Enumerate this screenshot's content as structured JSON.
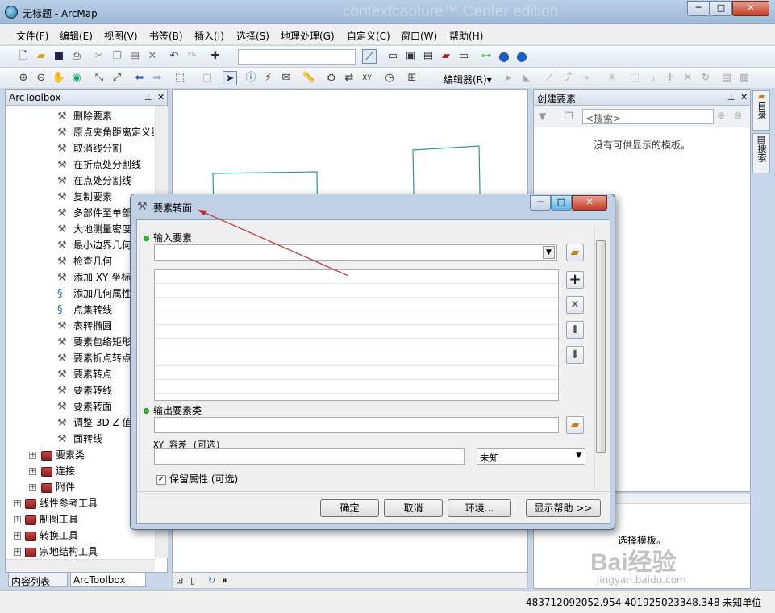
{
  "window": {
    "title": "无标题 - ArcMap",
    "watermark": "contextcapture™ Center edition",
    "min": "─",
    "max": "□",
    "close": "✕"
  },
  "menu": [
    "文件(F)",
    "编辑(E)",
    "视图(V)",
    "书签(B)",
    "插入(I)",
    "选择(S)",
    "地理处理(G)",
    "自定义(C)",
    "窗口(W)",
    "帮助(H)"
  ],
  "toolbar2": {
    "editor_label": "编辑器(R)▾"
  },
  "toolbox": {
    "title": "ArcToolbox",
    "items": [
      "删除要素",
      "原点夹角距离定义线",
      "取消线分割",
      "在折点处分割线",
      "在点处分割线",
      "复制要素",
      "多部件至单部件",
      "大地测量密度",
      "最小边界几何",
      "检查几何",
      "添加 XY 坐标",
      "添加几何属性",
      "点集转线",
      "表转椭圆",
      "要素包络矩形",
      "要素折点转点",
      "要素转点",
      "要素转线",
      "要素转面",
      "调整 3D Z 值",
      "面转线"
    ],
    "sets": [
      "要素类",
      "连接",
      "附件"
    ],
    "toolboxes": [
      "线性参考工具",
      "制图工具",
      "转换工具",
      "宗地结构工具"
    ],
    "tabs": [
      "内容列表",
      "ArcToolbox"
    ]
  },
  "create_features": {
    "title": "创建要素",
    "search_placeholder": "<搜索>",
    "empty_msg": "没有可供显示的模板。",
    "bottom_msg": "选择模板。"
  },
  "side_tabs": [
    "目录",
    "搜索"
  ],
  "dialog": {
    "title": "要素转面",
    "input_label": "输入要素",
    "output_label": "输出要素类",
    "xy_label": "XY 容差 (可选)",
    "xy_unit": "未知",
    "keep_attr": "保留属性 (可选)",
    "buttons": {
      "ok": "确定",
      "cancel": "取消",
      "env": "环境...",
      "help": "显示帮助 >>"
    }
  },
  "status": {
    "coords": "483712092052.954   401925023348.348 未知单位"
  },
  "baidu": {
    "logo": "Bai经验",
    "url": "jingyan.baidu.com"
  }
}
